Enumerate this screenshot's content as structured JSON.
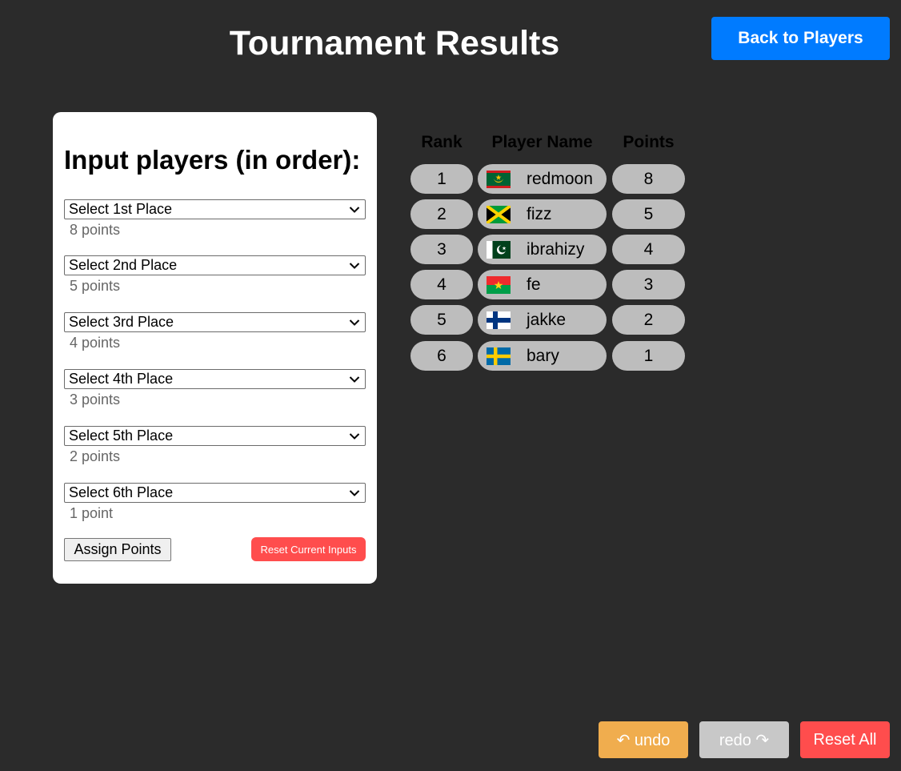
{
  "header": {
    "title": "Tournament Results",
    "back_button": "Back to Players"
  },
  "input_panel": {
    "heading": "Input players (in order):",
    "places": [
      {
        "placeholder": "Select 1st Place",
        "points": "8 points"
      },
      {
        "placeholder": "Select 2nd Place",
        "points": "5 points"
      },
      {
        "placeholder": "Select 3rd Place",
        "points": "4 points"
      },
      {
        "placeholder": "Select 4th Place",
        "points": "3 points"
      },
      {
        "placeholder": "Select 5th Place",
        "points": "2 points"
      },
      {
        "placeholder": "Select 6th Place",
        "points": "1 point"
      }
    ],
    "assign_button": "Assign Points",
    "reset_button": "Reset Current Inputs"
  },
  "results": {
    "headers": {
      "rank": "Rank",
      "name": "Player Name",
      "points": "Points"
    },
    "rows": [
      {
        "rank": "1",
        "flag": "mauritania-flag-icon",
        "name": "redmoon",
        "points": "8"
      },
      {
        "rank": "2",
        "flag": "jamaica-flag-icon",
        "name": "fizz",
        "points": "5"
      },
      {
        "rank": "3",
        "flag": "pakistan-flag-icon",
        "name": "ibrahizy",
        "points": "4"
      },
      {
        "rank": "4",
        "flag": "burkina-faso-flag-icon",
        "name": "fe",
        "points": "3"
      },
      {
        "rank": "5",
        "flag": "finland-flag-icon",
        "name": "jakke",
        "points": "2"
      },
      {
        "rank": "6",
        "flag": "sweden-flag-icon",
        "name": "bary",
        "points": "1"
      }
    ]
  },
  "footer": {
    "undo": "↶ undo",
    "redo": "redo ↷",
    "reset_all": "Reset All"
  },
  "colors": {
    "background": "#2b2b2b",
    "primary": "#007bff",
    "danger": "#ff4d4d",
    "warning": "#f0ad4e",
    "disabled": "#c8c8c8",
    "pill": "#bdbdbd"
  }
}
